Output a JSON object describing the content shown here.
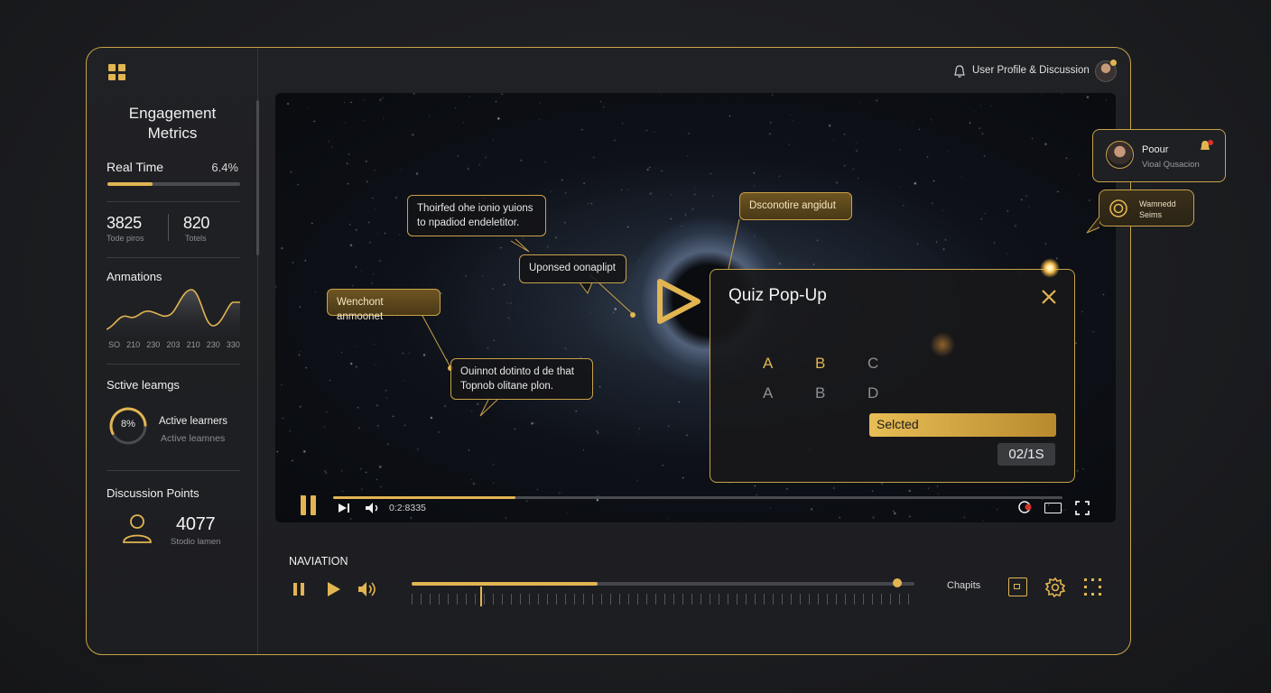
{
  "header": {
    "profile_label": "User Profile & Discussion"
  },
  "sidebar": {
    "title_line1": "Engagement",
    "title_line2": "Metrics",
    "realtime_label": "Real Time",
    "realtime_value": "6.4%",
    "realtime_progress": 0.34,
    "stat1_value": "3825",
    "stat1_label": "Tode piros",
    "stat2_value": "820",
    "stat2_label": "Totels",
    "animations_label": "Anmations",
    "chart_ticks": [
      "SO",
      "210",
      "230",
      "203",
      "210",
      "230",
      "330"
    ],
    "active_section_label": "Sctive leamgs",
    "active_ring_value": "8%",
    "active_title": "Active learners",
    "active_subtitle": "Active leamnes",
    "discussion_label": "Discussion Points",
    "discussion_value": "4077",
    "discussion_sub": "Stodio lamen"
  },
  "video": {
    "callout1_line1": "Thoirfed ohe ionio yuions",
    "callout1_line2": "to npadiod endeletitor.",
    "callout2": "Uponsed oonaplipt",
    "callout3": "Wenchont anmoonet",
    "callout4_line1": "Ouinnot dotinto d de that",
    "callout4_line2": "Topnob olitane plon.",
    "callout5": "Dsconotire angidut",
    "time": "0:2:8335",
    "progress": 0.25
  },
  "quiz": {
    "title": "Quiz Pop-Up",
    "row1": [
      "A",
      "B",
      "C"
    ],
    "row2": [
      "A",
      "B",
      "D"
    ],
    "selected_label": "Selcted",
    "count": "02/1S"
  },
  "floating": {
    "card1_title": "Poour",
    "card1_sub": "Vioal Qusacion",
    "card2_line1": "Wamnedd",
    "card2_line2": "Seims"
  },
  "navigation": {
    "label": "NAVIATION",
    "chapters_label": "Chapits",
    "timeline_progress": 0.37
  },
  "colors": {
    "accent": "#e2b552",
    "frame": "#c9a24a",
    "background": "#1b1c1f"
  }
}
